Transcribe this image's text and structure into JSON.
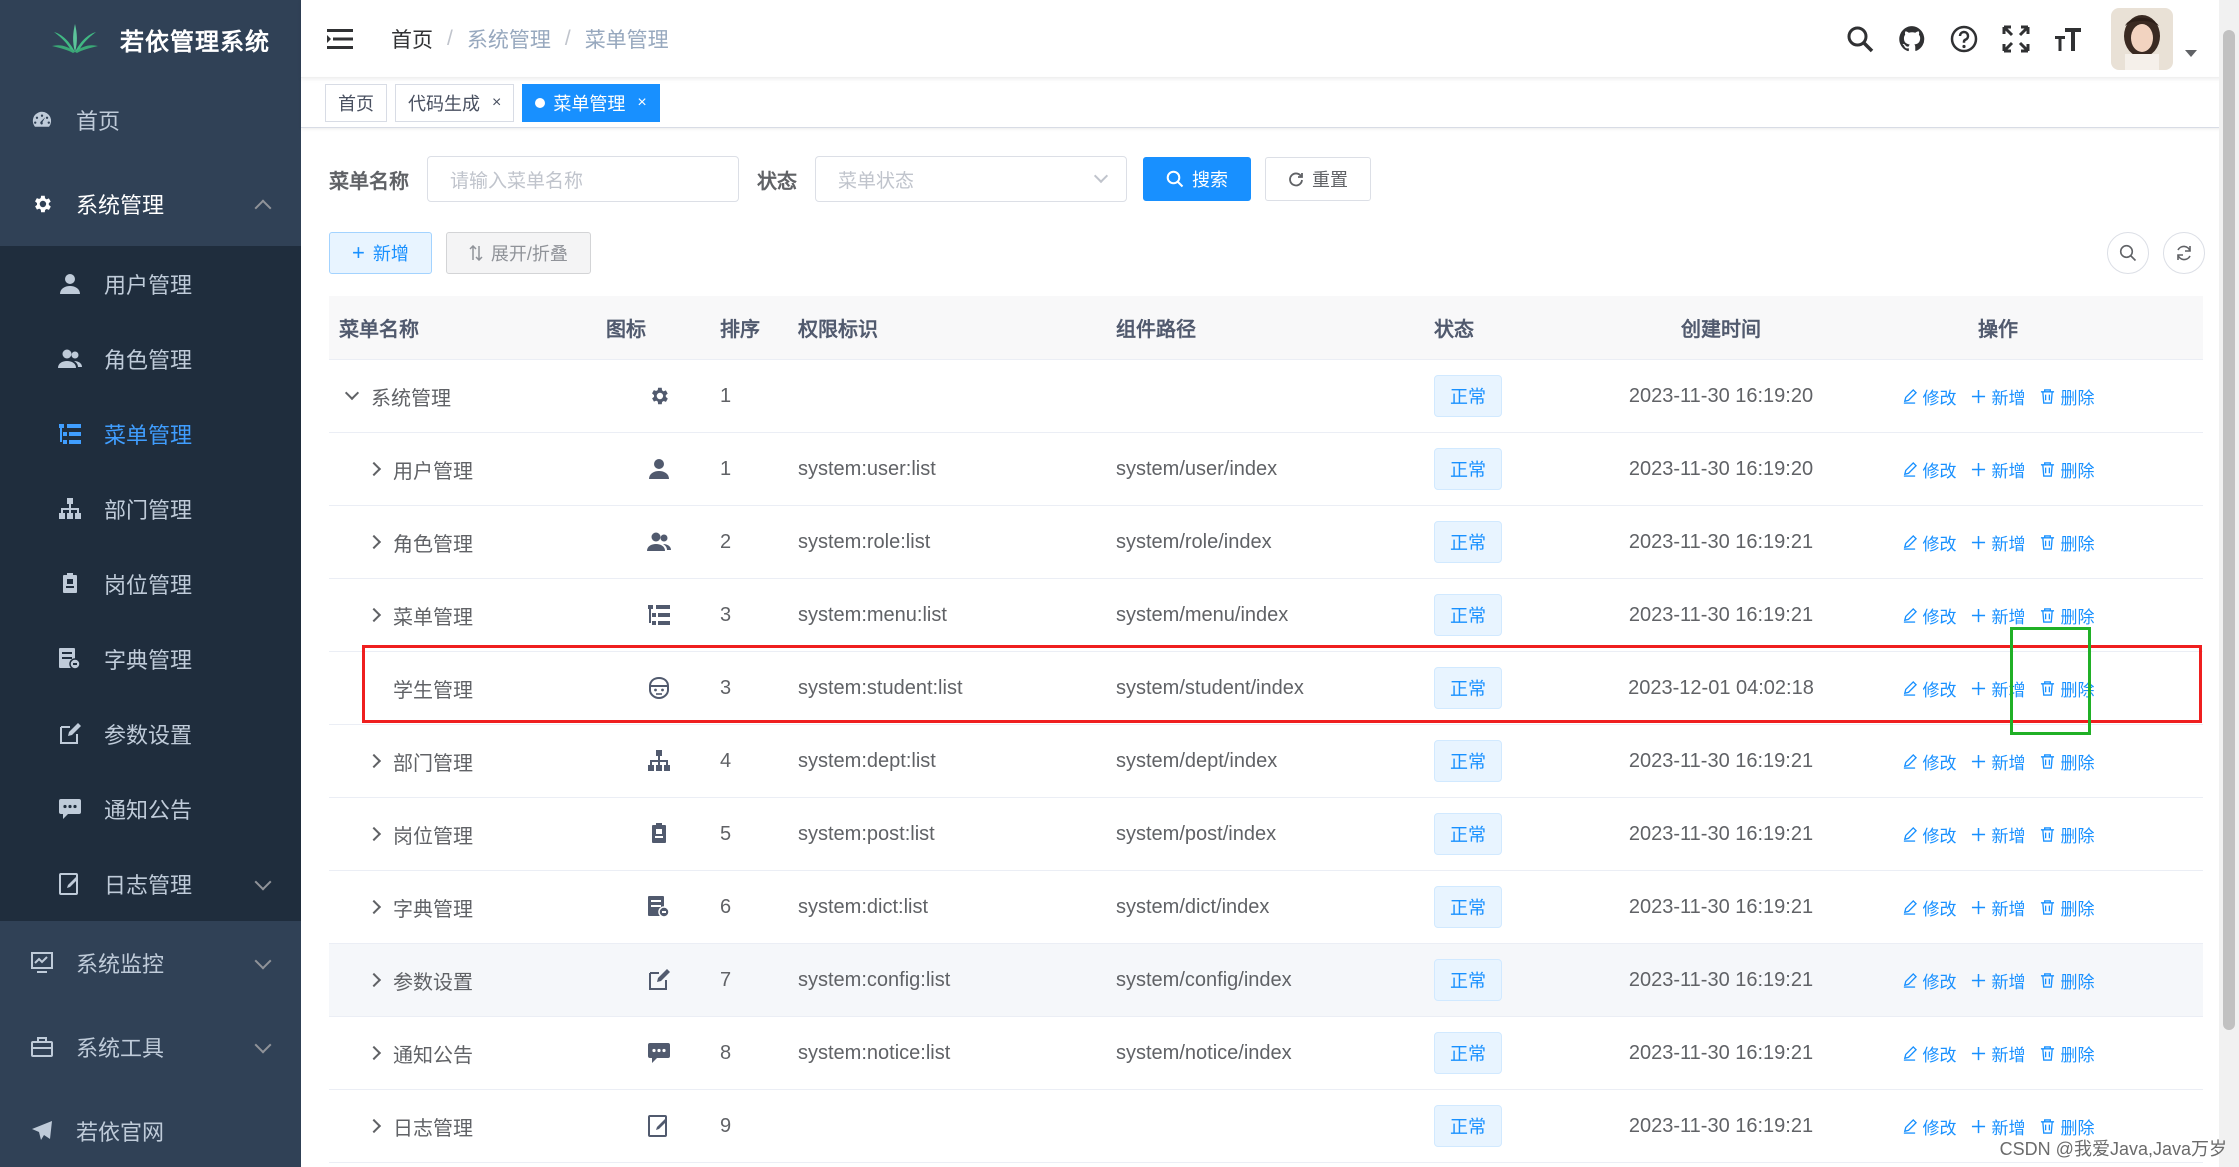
{
  "sidebar": {
    "title": "若依管理系统",
    "items": [
      {
        "label": "首页",
        "icon": "dashboard-icon"
      },
      {
        "label": "系统管理",
        "icon": "gear-icon",
        "expanded": true
      },
      {
        "label": "系统监控",
        "icon": "monitor-icon"
      },
      {
        "label": "系统工具",
        "icon": "toolbox-icon"
      },
      {
        "label": "若依官网",
        "icon": "send-icon"
      }
    ],
    "sub_items": [
      {
        "label": "用户管理",
        "icon": "user-icon"
      },
      {
        "label": "角色管理",
        "icon": "peoples-icon"
      },
      {
        "label": "菜单管理",
        "icon": "tree-table-icon",
        "active": true
      },
      {
        "label": "部门管理",
        "icon": "tree-icon"
      },
      {
        "label": "岗位管理",
        "icon": "post-icon"
      },
      {
        "label": "字典管理",
        "icon": "dict-icon"
      },
      {
        "label": "参数设置",
        "icon": "edit-icon"
      },
      {
        "label": "通知公告",
        "icon": "message-icon"
      },
      {
        "label": "日志管理",
        "icon": "log-icon"
      }
    ]
  },
  "navbar": {
    "breadcrumb": [
      "首页",
      "系统管理",
      "菜单管理"
    ],
    "icons": [
      "search-icon",
      "github-icon",
      "help-icon",
      "fullscreen-icon",
      "font-size-icon"
    ]
  },
  "tags": [
    {
      "label": "首页",
      "closable": false,
      "active": false
    },
    {
      "label": "代码生成",
      "closable": true,
      "active": false
    },
    {
      "label": "菜单管理",
      "closable": true,
      "active": true
    }
  ],
  "search": {
    "name_label": "菜单名称",
    "name_placeholder": "请输入菜单名称",
    "status_label": "状态",
    "status_placeholder": "菜单状态",
    "search_button": "搜索",
    "reset_button": "重置"
  },
  "toolbar": {
    "add_button": "新增",
    "expand_button": "展开/折叠"
  },
  "table": {
    "columns": [
      "菜单名称",
      "图标",
      "排序",
      "权限标识",
      "组件路径",
      "状态",
      "创建时间",
      "操作"
    ],
    "ops": {
      "edit": "修改",
      "add": "新增",
      "delete": "删除"
    },
    "rows": [
      {
        "name": "系统管理",
        "level": 0,
        "expander": "down",
        "icon": "gear-icon",
        "order": "1",
        "perm": "",
        "component": "",
        "status": "正常",
        "created": "2023-11-30 16:19:20"
      },
      {
        "name": "用户管理",
        "level": 1,
        "expander": "right",
        "icon": "user-icon",
        "order": "1",
        "perm": "system:user:list",
        "component": "system/user/index",
        "status": "正常",
        "created": "2023-11-30 16:19:20"
      },
      {
        "name": "角色管理",
        "level": 1,
        "expander": "right",
        "icon": "peoples-icon",
        "order": "2",
        "perm": "system:role:list",
        "component": "system/role/index",
        "status": "正常",
        "created": "2023-11-30 16:19:21"
      },
      {
        "name": "菜单管理",
        "level": 1,
        "expander": "right",
        "icon": "tree-table-icon",
        "order": "3",
        "perm": "system:menu:list",
        "component": "system/menu/index",
        "status": "正常",
        "created": "2023-11-30 16:19:21"
      },
      {
        "name": "学生管理",
        "level": 1,
        "expander": "none",
        "icon": "education-icon",
        "order": "3",
        "perm": "system:student:list",
        "component": "system/student/index",
        "status": "正常",
        "created": "2023-12-01 04:02:18"
      },
      {
        "name": "部门管理",
        "level": 1,
        "expander": "right",
        "icon": "tree-icon",
        "order": "4",
        "perm": "system:dept:list",
        "component": "system/dept/index",
        "status": "正常",
        "created": "2023-11-30 16:19:21"
      },
      {
        "name": "岗位管理",
        "level": 1,
        "expander": "right",
        "icon": "post-icon",
        "order": "5",
        "perm": "system:post:list",
        "component": "system/post/index",
        "status": "正常",
        "created": "2023-11-30 16:19:21"
      },
      {
        "name": "字典管理",
        "level": 1,
        "expander": "right",
        "icon": "dict-icon",
        "order": "6",
        "perm": "system:dict:list",
        "component": "system/dict/index",
        "status": "正常",
        "created": "2023-11-30 16:19:21"
      },
      {
        "name": "参数设置",
        "level": 1,
        "expander": "right",
        "icon": "edit-icon",
        "order": "7",
        "perm": "system:config:list",
        "component": "system/config/index",
        "status": "正常",
        "created": "2023-11-30 16:19:21",
        "hover": true
      },
      {
        "name": "通知公告",
        "level": 1,
        "expander": "right",
        "icon": "message-icon",
        "order": "8",
        "perm": "system:notice:list",
        "component": "system/notice/index",
        "status": "正常",
        "created": "2023-11-30 16:19:21"
      },
      {
        "name": "日志管理",
        "level": 1,
        "expander": "right",
        "icon": "log-icon",
        "order": "9",
        "perm": "",
        "component": "",
        "status": "正常",
        "created": "2023-11-30 16:19:21"
      }
    ]
  },
  "annotations": {
    "highlight_row_color": "#ef1f1f",
    "highlight_op_color": "#20b026"
  },
  "watermark": "CSDN @我爱Java,Java万岁",
  "colors": {
    "sidebar_bg": "#304156",
    "submenu_bg": "#1f2d3d",
    "primary": "#1890ff",
    "active_menu": "#409eff"
  }
}
